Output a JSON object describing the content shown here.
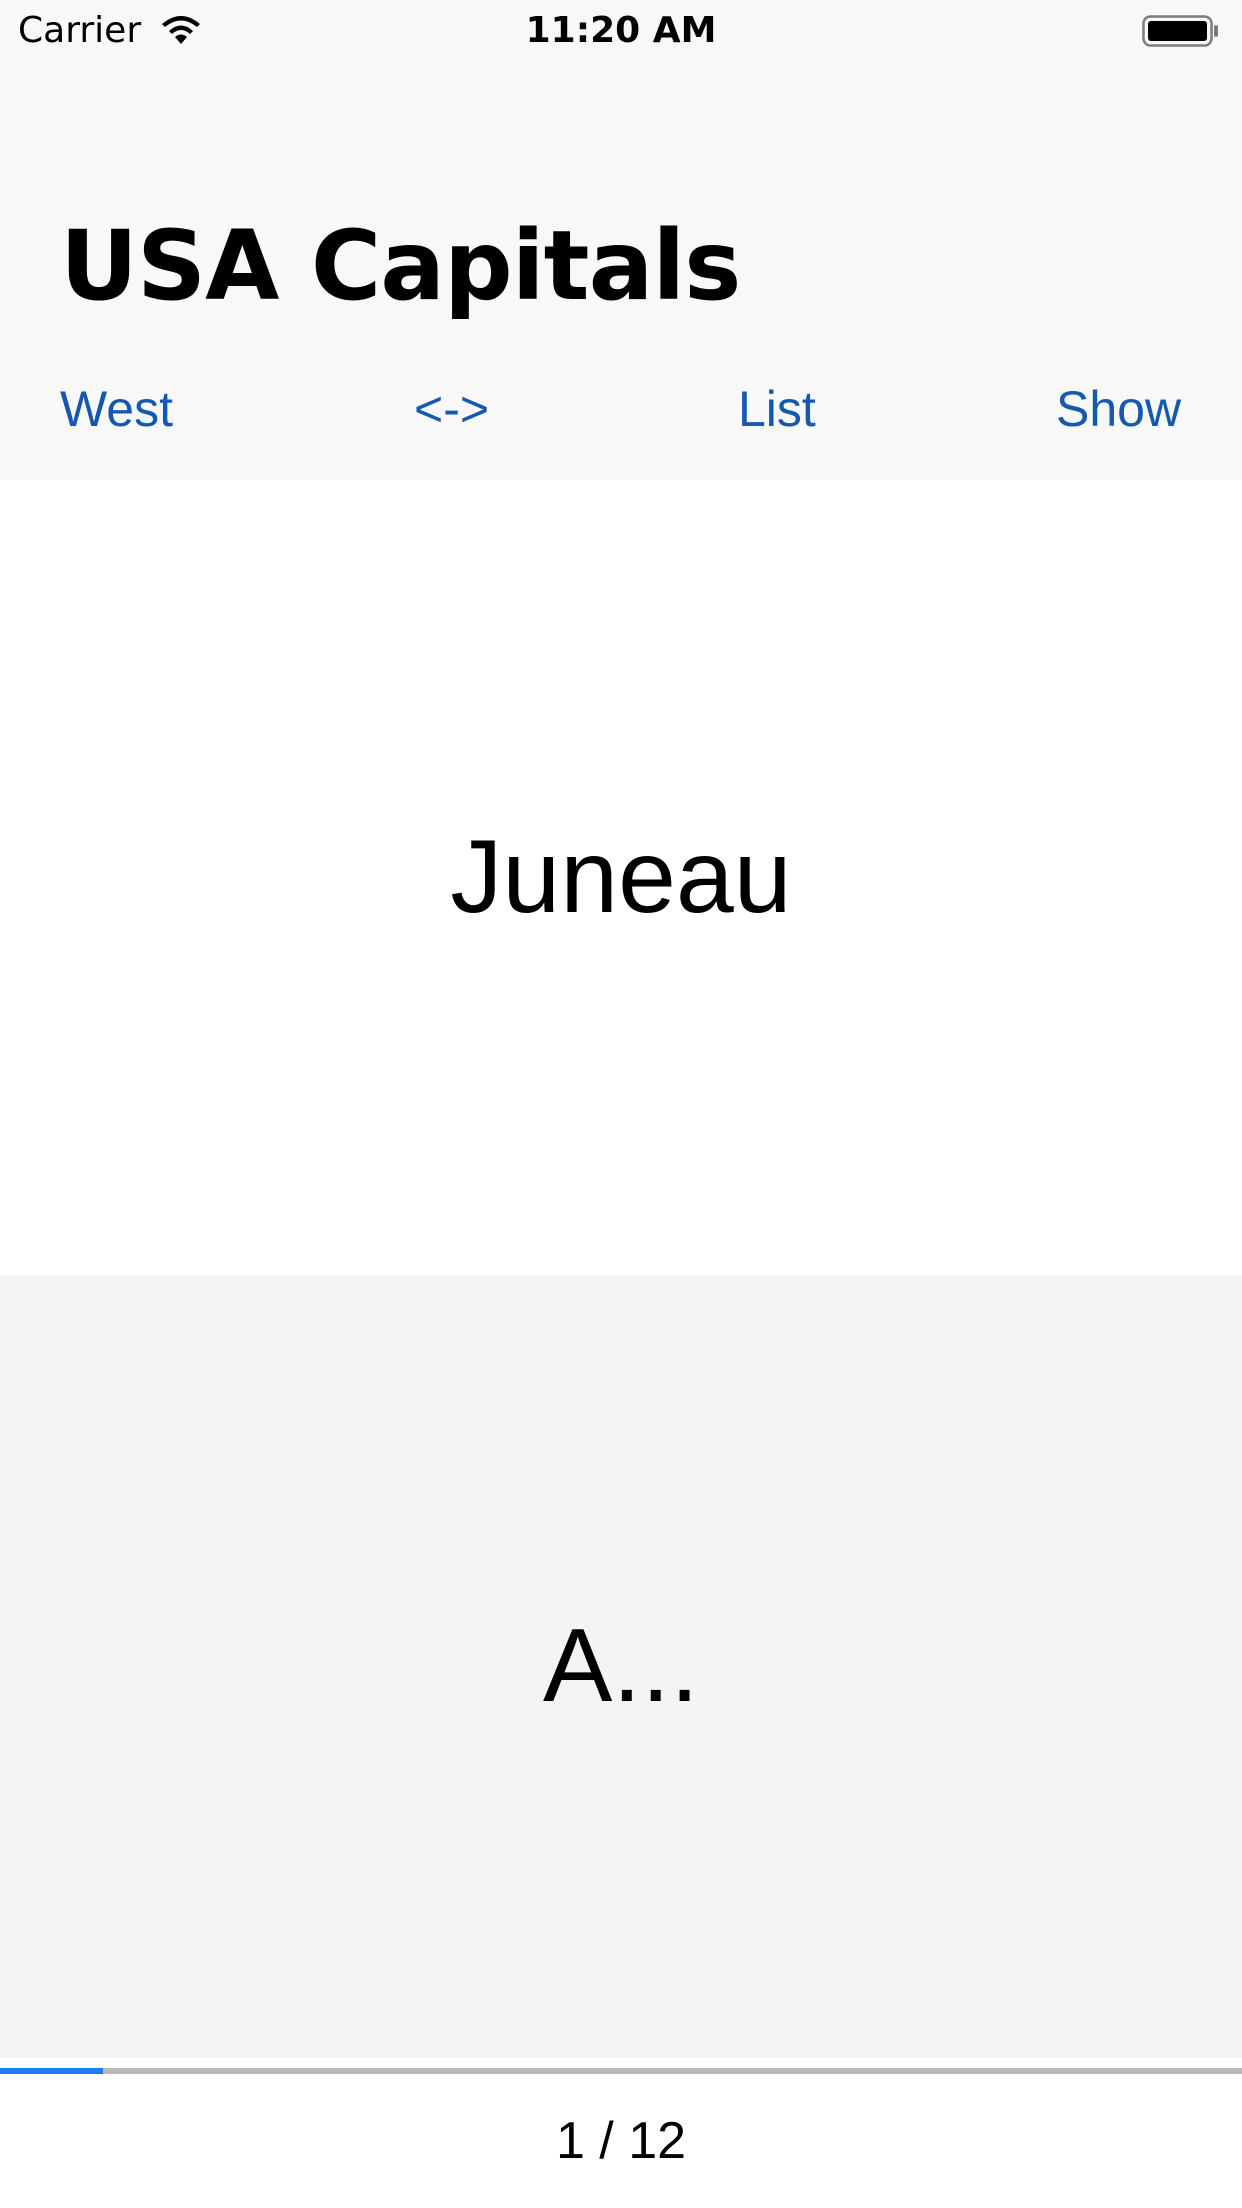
{
  "status_bar": {
    "carrier": "Carrier",
    "time": "11:20 AM",
    "wifi_icon": "wifi-icon",
    "battery_icon": "battery-icon"
  },
  "nav": {
    "title": "USA Capitals"
  },
  "toolbar": {
    "west_label": "West",
    "swap_label": "<->",
    "list_label": "List",
    "show_label": "Show",
    "accent_color": "#1558b0"
  },
  "card": {
    "question": "Juneau",
    "answer": "A..."
  },
  "progress": {
    "current": 1,
    "total": 12,
    "fraction": 0.0833,
    "fill_color": "#1a7ef5",
    "label": "1 / 12"
  }
}
